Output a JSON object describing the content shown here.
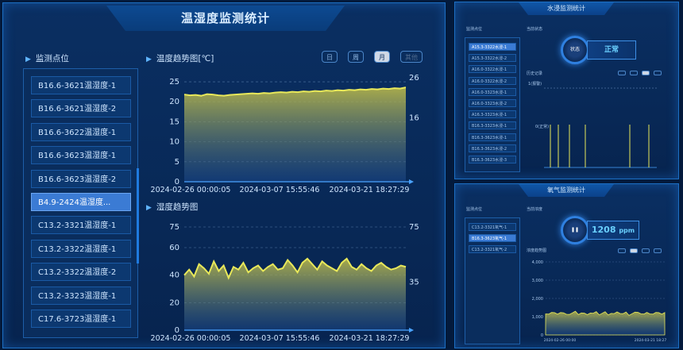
{
  "main": {
    "title": "温湿度监测统计",
    "points_label": "监测点位",
    "points": [
      "B16.6-3621温湿度-1",
      "B16.6-3621温湿度-2",
      "B16.6-3622温湿度-1",
      "B16.6-3623温湿度-1",
      "B16.6-3623温湿度-2",
      "B4.9-2424温湿度...",
      "C13.2-3321温湿度-1",
      "C13.2-3322温湿度-1",
      "C13.2-3322温湿度-2",
      "C13.2-3323温湿度-1",
      "C17.6-3723温湿度-1"
    ],
    "selected_index": 5,
    "range_buttons": [
      "日",
      "周",
      "月",
      "其他"
    ],
    "active_range": "月",
    "temp_chart": {
      "title": "温度趋势图[℃]",
      "y_ticks": [
        "25",
        "20",
        "15",
        "10",
        "5",
        "0"
      ],
      "right_ticks": [
        "26",
        "16"
      ],
      "x_ticks": [
        "2024-02-26 00:00:05",
        "2024-03-07 15:55:46",
        "2024-03-21 18:27:29"
      ]
    },
    "hum_chart": {
      "title": "湿度趋势图",
      "y_ticks": [
        "75",
        "60",
        "40",
        "20",
        "0"
      ],
      "right_ticks": [
        "75",
        "35"
      ],
      "x_ticks": [
        "2024-02-26 00:00:05",
        "2024-03-07 15:55:46",
        "2024-03-21 18:27:29"
      ]
    }
  },
  "chart_data": [
    {
      "type": "area",
      "title": "温度趋势图[℃]",
      "x_range": [
        "2024-02-26 00:00:05",
        "2024-03-21 18:27:29"
      ],
      "ylim": [
        0,
        26
      ],
      "series": [
        {
          "values": [
            21.8,
            21.6,
            21.7,
            21.5,
            21.9,
            21.8,
            21.6,
            21.5,
            21.7,
            21.8,
            21.9,
            22.0,
            22.1,
            22.0,
            22.2,
            22.1,
            22.3,
            22.4,
            22.3,
            22.5,
            22.4,
            22.6,
            22.5,
            22.7,
            22.6,
            22.8,
            22.7,
            22.9,
            22.8,
            23.0,
            22.9,
            23.1,
            23.0,
            23.2,
            23.1,
            23.3,
            23.2,
            23.4,
            23.3,
            23.6
          ]
        }
      ]
    },
    {
      "type": "area",
      "title": "湿度趋势图",
      "x_range": [
        "2024-02-26 00:00:05",
        "2024-03-21 18:27:29"
      ],
      "ylim": [
        0,
        75
      ],
      "series": [
        {
          "values": [
            40,
            44,
            39,
            48,
            45,
            41,
            50,
            43,
            47,
            38,
            46,
            44,
            49,
            42,
            45,
            47,
            43,
            46,
            48,
            44,
            45,
            51,
            47,
            42,
            49,
            52,
            48,
            44,
            50,
            47,
            45,
            43,
            49,
            52,
            46,
            44,
            48,
            45,
            43,
            47,
            49,
            46,
            44,
            45,
            47,
            46
          ]
        }
      ]
    }
  ],
  "water": {
    "title": "水浸监测统计",
    "points_label": "监测点位",
    "status_label": "当前状态",
    "circle_label": "状态",
    "status_value": "正常",
    "history_label": "历史记录",
    "points": [
      "A15.3-3322水浸-1",
      "A15.3-3322水浸-2",
      "A16.0-3322水浸-1",
      "A16.0-3322水浸-2",
      "A16.0-3323水浸-1",
      "A16.0-3323水浸-2",
      "A16.3-3323水浸-1",
      "B16.3-3323水浸-1",
      "B16.3-3623水浸-1",
      "B16.3-3623水浸-2",
      "B16.3-3623水浸-3"
    ],
    "y_labels": [
      "1(报警)",
      "0(正常)"
    ]
  },
  "co2": {
    "title": "氧气监测统计",
    "points_label": "监测点位",
    "status_label": "当前浓度",
    "value": "1208",
    "unit": "ppm",
    "trend_label": "浓度趋势图",
    "points": [
      "C13.2-3321氧气-1",
      "B16.3-3623氧气-1",
      "C13.2-3321氧气-2"
    ],
    "y_ticks": [
      "4,000",
      "3,000",
      "2,000",
      "1,000",
      "0"
    ],
    "x_ticks": [
      "2024-02-26 00:00",
      "2024-03-21 18:27"
    ]
  },
  "colors": {
    "line": "#e8e85a",
    "panel_border": "#1c6fc4",
    "accent": "#2f80e0"
  }
}
